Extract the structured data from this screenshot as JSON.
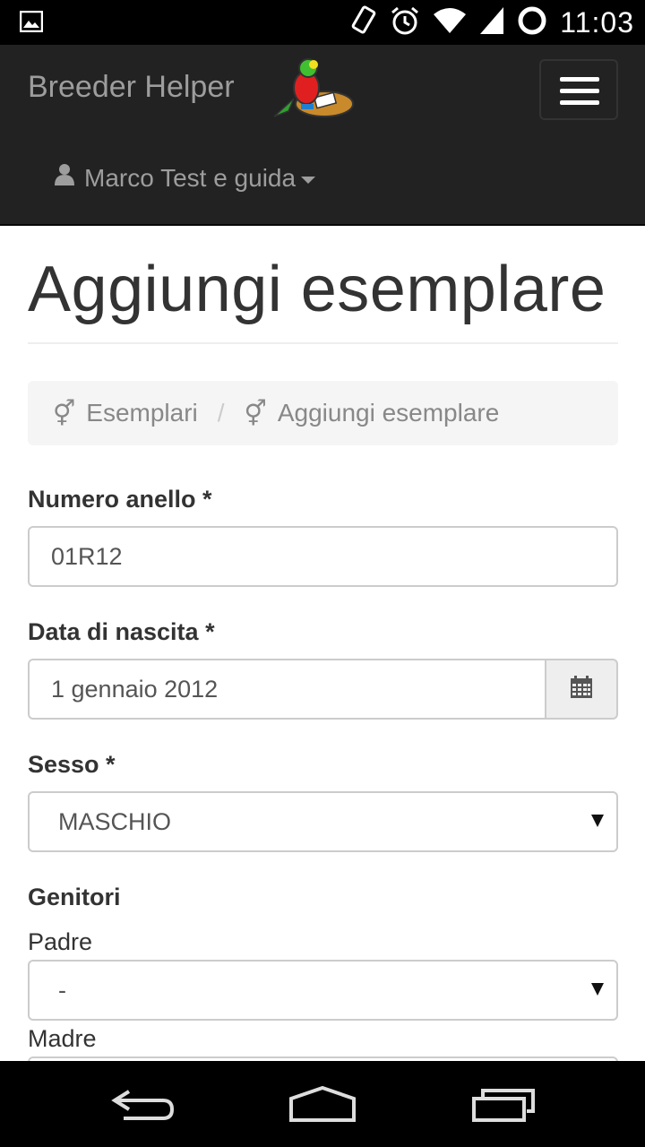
{
  "status_bar": {
    "time": "11:03",
    "icons": [
      "image-icon",
      "vibrate-icon",
      "alarm-icon",
      "wifi-icon",
      "signal-icon",
      "sync-icon"
    ]
  },
  "navbar": {
    "brand": "Breeder Helper",
    "logo": "parrot-at-desk-logo",
    "user_menu_label": "Marco Test e guida"
  },
  "page": {
    "title": "Aggiungi esemplare"
  },
  "breadcrumb": {
    "items": [
      {
        "icon": "gender-icon",
        "label": "Esemplari"
      },
      {
        "icon": "gender-icon",
        "label": "Aggiungi esemplare"
      }
    ],
    "separator": "/"
  },
  "form": {
    "ring_number": {
      "label": "Numero anello *",
      "value": "01R12"
    },
    "birth_date": {
      "label": "Data di nascita *",
      "value": "1 gennaio 2012"
    },
    "sex": {
      "label": "Sesso *",
      "value": "MASCHIO"
    },
    "parents": {
      "label": "Genitori",
      "father": {
        "label": "Padre",
        "value": "-"
      },
      "mother": {
        "label": "Madre"
      }
    }
  },
  "system_nav": {
    "icons": [
      "back-icon",
      "home-icon",
      "recents-icon"
    ]
  },
  "colors": {
    "navbar_bg": "#222222",
    "navbar_text": "#9d9d9d",
    "breadcrumb_bg": "#f5f5f5",
    "input_border": "#cccccc"
  }
}
